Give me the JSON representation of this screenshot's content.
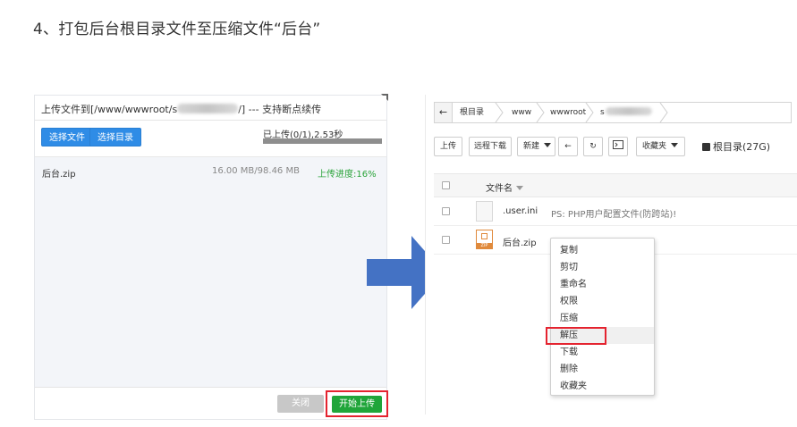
{
  "heading": "4、打包后台根目录文件至压缩文件“后台”",
  "upload": {
    "title_prefix": "上传文件到[/www/wwwroot/s",
    "title_suffix": "/] --- 支持断点续传",
    "select_file": "选择文件",
    "select_dir": "选择目录",
    "count_text": "已上传(0/1),2.53秒",
    "progress_fraction": 1.0,
    "file": {
      "name": "后台.zip",
      "size": "16.00 MB/98.46 MB",
      "progress": "上传进度:16%"
    },
    "close": "关闭",
    "start": "开始上传",
    "colors": {
      "blue": "#2f8ce6",
      "green": "#20a53a",
      "highlight": "#e4232f"
    }
  },
  "fm": {
    "breadcrumb": [
      "根目录",
      "www",
      "wwwroot",
      "s"
    ],
    "toolbar": {
      "upload": "上传",
      "remote": "远程下载",
      "new": "新建",
      "favorites": "收藏夹"
    },
    "disk": "根目录(27G)",
    "column_name": "文件名",
    "rows": [
      {
        "name": ".user.ini",
        "desc": "PS: PHP用户配置文件(防跨站)!"
      },
      {
        "name": "后台.zip",
        "desc": ""
      }
    ],
    "context_menu": [
      "复制",
      "剪切",
      "重命名",
      "权限",
      "压缩",
      "解压",
      "下载",
      "删除",
      "收藏夹"
    ],
    "highlighted_item": "解压"
  }
}
